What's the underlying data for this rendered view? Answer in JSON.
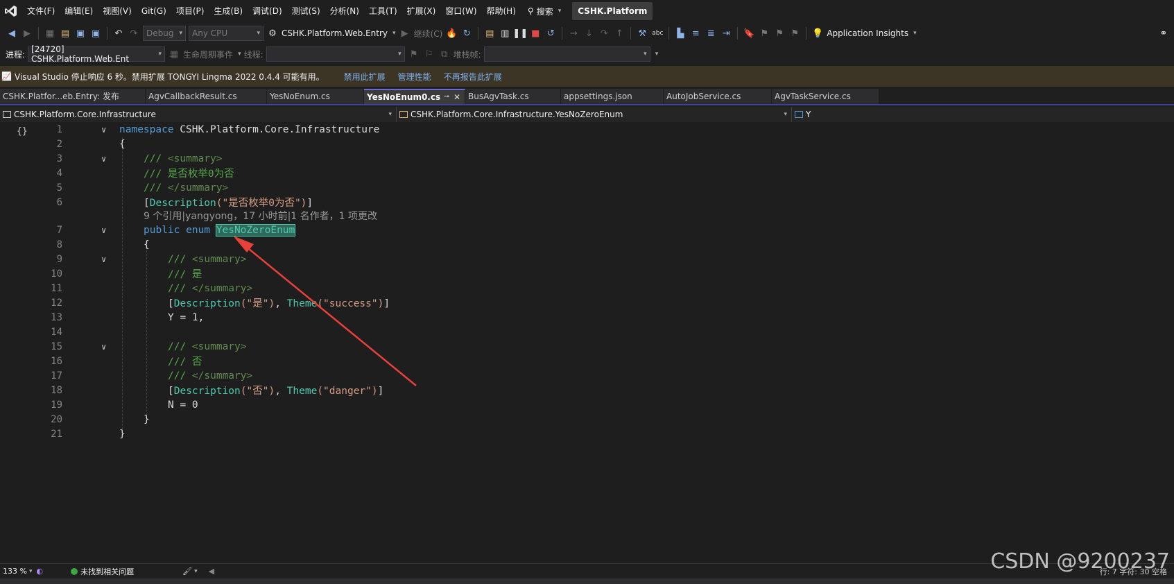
{
  "menu": [
    "文件(F)",
    "编辑(E)",
    "视图(V)",
    "Git(G)",
    "项目(P)",
    "生成(B)",
    "调试(D)",
    "测试(S)",
    "分析(N)",
    "工具(T)",
    "扩展(X)",
    "窗口(W)",
    "帮助(H)"
  ],
  "search_label": "搜索",
  "solution_name": "CSHK.Platform",
  "toolbar": {
    "config": "Debug",
    "platform": "Any CPU",
    "startup_project": "CSHK.Platform.Web.Entry",
    "continue_label": "继续(C)",
    "app_insights": "Application Insights"
  },
  "debugbar": {
    "process_label": "进程:",
    "process_value": "[24720] CSHK.Platform.Web.Ent",
    "lifecycle_label": "生命周期事件",
    "thread_label": "线程:",
    "stack_label": "堆栈帧:"
  },
  "infobar": {
    "message": "Visual Studio 停止响应 6 秒。禁用扩展 TONGYI Lingma 2022 0.4.4 可能有用。",
    "links": [
      "禁用此扩展",
      "管理性能",
      "不再报告此扩展"
    ]
  },
  "tabs": [
    {
      "label": "CSHK.Platfor...eb.Entry: 发布",
      "active": false
    },
    {
      "label": "AgvCallbackResult.cs",
      "active": false
    },
    {
      "label": "YesNoEnum.cs",
      "active": false
    },
    {
      "label": "YesNoEnum0.cs",
      "active": true
    },
    {
      "label": "BusAgvTask.cs",
      "active": false
    },
    {
      "label": "appsettings.json",
      "active": false
    },
    {
      "label": "AutoJobService.cs",
      "active": false
    },
    {
      "label": "AgvTaskService.cs",
      "active": false
    }
  ],
  "navbar": {
    "project": "CSHK.Platform.Core.Infrastructure",
    "type": "CSHK.Platform.Core.Infrastructure.YesNoZeroEnum",
    "member": "Y"
  },
  "code_lens": "9 个引用|yangyong，17 小时前|1 名作者，1 项更改",
  "line_numbers": [
    "1",
    "2",
    "3",
    "4",
    "5",
    "6",
    "7",
    "8",
    "9",
    "10",
    "11",
    "12",
    "13",
    "14",
    "15",
    "16",
    "17",
    "18",
    "19",
    "20",
    "21"
  ],
  "code": {
    "l1_kw": "namespace",
    "l1_name": " CSHK.Platform.Core.Infrastructure",
    "l2": "{",
    "l3_slash": "/// ",
    "l3_tag": "<summary>",
    "l4": "/// 是否枚举0为否",
    "l5_slash": "/// ",
    "l5_tag": "</summary>",
    "l6_open": "[",
    "l6_attr": "Description",
    "l6_str": "(\"是否枚举0为否\")",
    "l6_close": "]",
    "l7_kw": "public enum ",
    "l7_name": "YesNoZeroEnum",
    "l8": "{",
    "l9_slash": "/// ",
    "l9_tag": "<summary>",
    "l10": "/// 是",
    "l11_slash": "/// ",
    "l11_tag": "</summary>",
    "l12_open": "[",
    "l12_attr1": "Description",
    "l12_str1": "(\"是\")",
    "l12_sep": ", ",
    "l12_attr2": "Theme",
    "l12_str2": "(\"success\")",
    "l12_close": "]",
    "l13": "Y = 1,",
    "l15_slash": "/// ",
    "l15_tag": "<summary>",
    "l16": "/// 否",
    "l17_slash": "/// ",
    "l17_tag": "</summary>",
    "l18_open": "[",
    "l18_attr1": "Description",
    "l18_str1": "(\"否\")",
    "l18_sep": ", ",
    "l18_attr2": "Theme",
    "l18_str2": "(\"danger\")",
    "l18_close": "]",
    "l19": "N = 0",
    "l20": "}",
    "l21": "}"
  },
  "status": {
    "zoom": "133 %",
    "issues": "未找到相关问题",
    "position": "行: 7    字符: 30    空格"
  },
  "watermark": "CSDN @9200237",
  "colors": {
    "keyword": "#569cd6",
    "comment": "#57a64a",
    "type": "#4ec9b0",
    "string": "#d69d85",
    "arrow": "#e8413a"
  }
}
